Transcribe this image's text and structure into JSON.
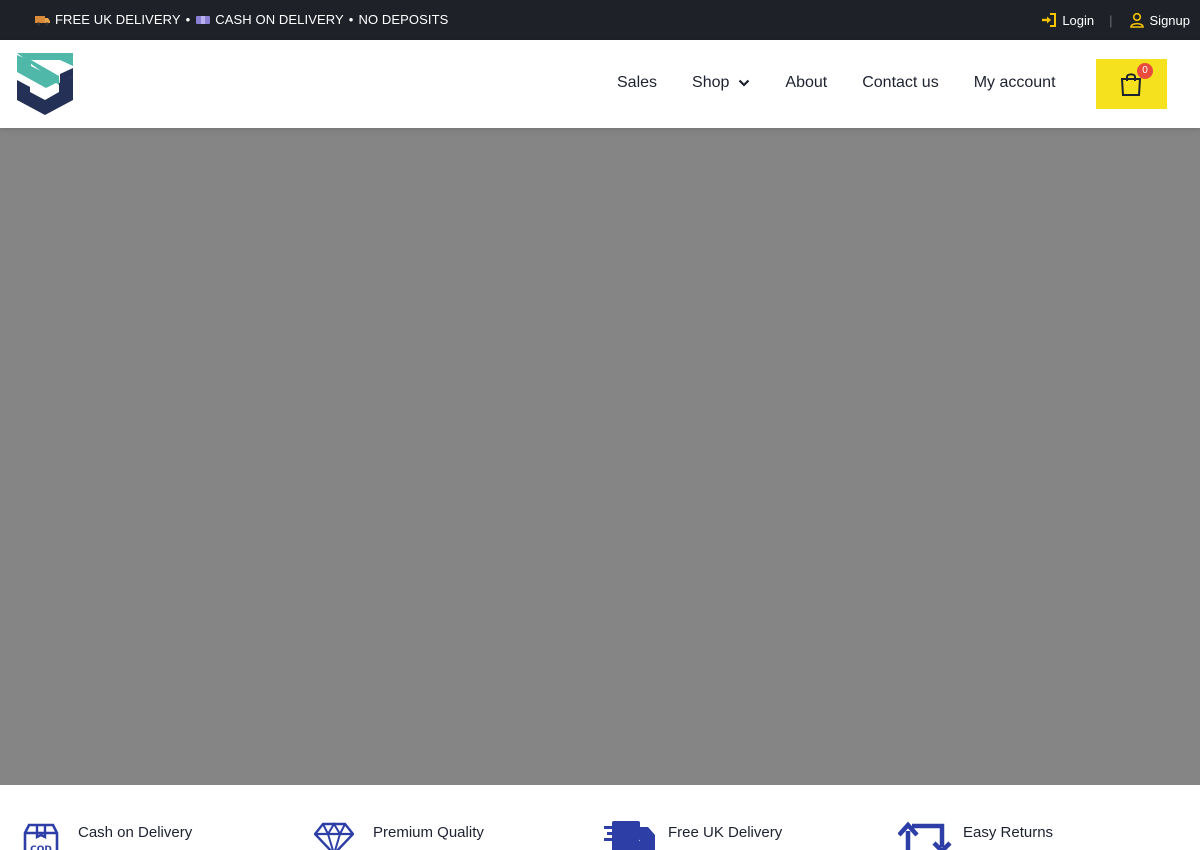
{
  "topbar": {
    "announcement": {
      "part1": "FREE UK DELIVERY",
      "bullet1": "•",
      "part2": "CASH ON DELIVERY",
      "bullet2": "•",
      "part3": "NO DEPOSITS",
      "icons": [
        "delivery-truck-emoji-icon",
        "banknote-emoji-icon"
      ]
    },
    "login_label": "Login",
    "signup_label": "Signup",
    "divider": "|"
  },
  "header": {
    "logo_icon": "shield-s-logo-icon",
    "nav": {
      "sales": "Sales",
      "shop": "Shop",
      "about": "About",
      "contact": "Contact us",
      "account": "My account"
    },
    "cart": {
      "count": "0",
      "icon": "shopping-bag-icon"
    }
  },
  "features": {
    "items": [
      {
        "title": "Cash on Delivery",
        "icon": "cod-box-icon"
      },
      {
        "title": "Premium Quality",
        "icon": "diamond-icon"
      },
      {
        "title": "Free UK Delivery",
        "icon": "fast-truck-icon"
      },
      {
        "title": "Easy Returns",
        "icon": "return-arrows-icon"
      }
    ]
  },
  "colors": {
    "topbar_bg": "#1e2128",
    "accent_yellow": "#f5e11e",
    "badge_red": "#e74c3c",
    "logo_teal": "#4fb8a9",
    "logo_navy": "#243055",
    "feature_icon_blue": "#2d3fa7",
    "hero_bg": "#858585"
  }
}
